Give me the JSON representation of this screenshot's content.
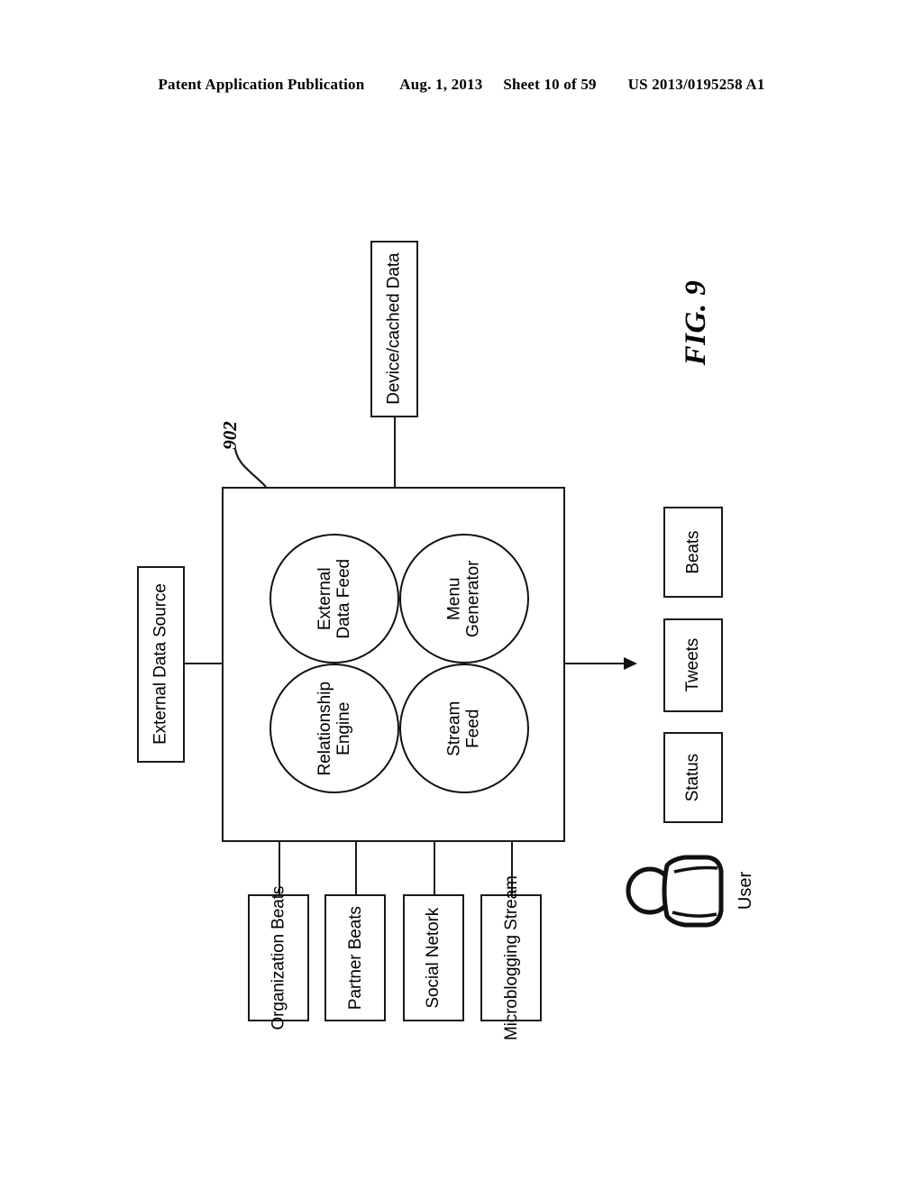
{
  "header": {
    "publication": "Patent Application Publication",
    "date": "Aug. 1, 2013",
    "sheet": "Sheet 10 of 59",
    "number": "US 2013/0195258 A1"
  },
  "figure": {
    "label": "FIG. 9",
    "reference_numeral": "902",
    "top_node": {
      "label": "Device/cached Data"
    },
    "left_node": {
      "label": "External Data Source"
    },
    "main_container": {
      "modules": [
        {
          "label": "External\nData Feed",
          "name": "external-data-feed"
        },
        {
          "label": "Menu\nGenerator",
          "name": "menu-generator"
        },
        {
          "label": "Relationship\nEngine",
          "name": "relationship-engine"
        },
        {
          "label": "Stream\nFeed",
          "name": "stream-feed"
        }
      ]
    },
    "bottom_nodes": [
      {
        "label": "Organization\nBeats",
        "name": "organization-beats"
      },
      {
        "label": "Partner\nBeats",
        "name": "partner-beats"
      },
      {
        "label": "Social Netork",
        "name": "social-network"
      },
      {
        "label": "Microblogging\nStream",
        "name": "microblogging-stream"
      }
    ],
    "output_nodes": [
      {
        "label": "Beats",
        "name": "beats"
      },
      {
        "label": "Tweets",
        "name": "tweets"
      },
      {
        "label": "Status",
        "name": "status"
      }
    ],
    "actor": {
      "label": "User"
    }
  },
  "colors": {
    "ink": "#1a1a1a",
    "background": "#ffffff"
  }
}
